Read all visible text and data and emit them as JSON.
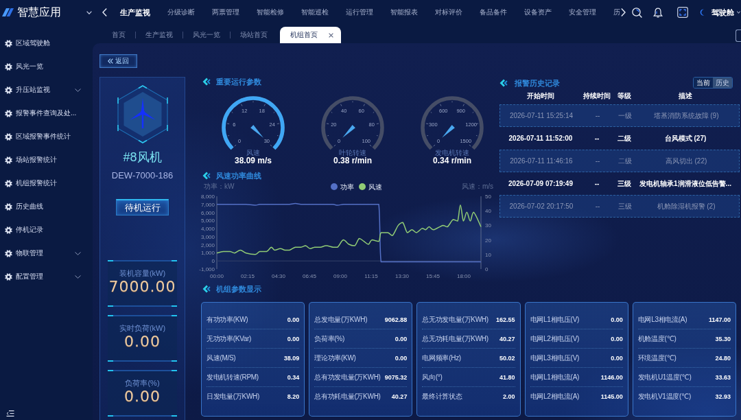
{
  "header": {
    "app_title": "智慧应用",
    "nav": [
      {
        "label": "生产监视",
        "selected": true
      },
      {
        "label": "分级诊断",
        "selected": false
      },
      {
        "label": "两票管理",
        "selected": false
      },
      {
        "label": "智能检修",
        "selected": false
      },
      {
        "label": "智能巡检",
        "selected": false
      },
      {
        "label": "运行管理",
        "selected": false
      },
      {
        "label": "智能报表",
        "selected": false
      },
      {
        "label": "对标评价",
        "selected": false
      },
      {
        "label": "备品备件",
        "selected": false
      },
      {
        "label": "设备资产",
        "selected": false
      },
      {
        "label": "安全管理",
        "selected": false
      },
      {
        "label": "历",
        "selected": false
      }
    ],
    "mode_switch": {
      "label": "驾驶舱",
      "dark_mode": true
    }
  },
  "tabs": [
    {
      "label": "首页",
      "selected": false
    },
    {
      "label": "生产监视",
      "selected": false
    },
    {
      "label": "风光一览",
      "selected": false
    },
    {
      "label": "场站首页",
      "selected": false
    },
    {
      "label": "机组首页",
      "selected": true
    }
  ],
  "sidebar": {
    "items": [
      {
        "label": "区域驾驶舱",
        "kind": "link"
      },
      {
        "label": "风光一览",
        "kind": "link"
      },
      {
        "label": "升压站监视",
        "kind": "group"
      },
      {
        "label": "报警事件查询及处...",
        "kind": "link"
      },
      {
        "label": "区域报警事件统计",
        "kind": "link"
      },
      {
        "label": "场站报警统计",
        "kind": "link"
      },
      {
        "label": "机组报警统计",
        "kind": "link"
      },
      {
        "label": "历史曲线",
        "kind": "link"
      },
      {
        "label": "停机记录",
        "kind": "link"
      },
      {
        "label": "物联管理",
        "kind": "group"
      },
      {
        "label": "配置管理",
        "kind": "group"
      }
    ]
  },
  "back_button": {
    "label": "返回"
  },
  "unit_panel": {
    "name": "#8风机",
    "model": "DEW-7000-186",
    "status": "待机运行",
    "stats": [
      {
        "label": "装机容量(kW)",
        "value": "7000.00"
      },
      {
        "label": "实时负荷(kW)",
        "value": "0.00"
      },
      {
        "label": "负荷率(%)",
        "value": "0.00"
      }
    ]
  },
  "run_params": {
    "title": "重要运行参数",
    "gauges": [
      {
        "label": "风速",
        "reading": "38.09 m/s",
        "level": 1,
        "ticks": [
          "0",
          "6",
          "12",
          "18",
          "24",
          "30"
        ]
      },
      {
        "label": "叶轮转速",
        "reading": "0.38 r/min",
        "ticks": [
          "0",
          "20",
          "40",
          "60",
          "80",
          "100"
        ]
      },
      {
        "label": "发电机转速",
        "reading": "0.34 r/min",
        "ticks": [
          "0",
          "300",
          "600",
          "900",
          "1200",
          "1500"
        ]
      }
    ]
  },
  "power_curve": {
    "title": "风速功率曲线",
    "chart_data": {
      "type": "line",
      "legend": "top",
      "ylabel": "功率：kW",
      "y2label": "风速：m/s",
      "x": [
        0,
        0.47,
        0.97,
        1.3,
        1.72,
        2.13,
        2.8,
        3.13,
        3.63,
        3.97,
        4.22,
        4.63,
        4.97,
        5.3,
        5.72,
        6.13,
        6.47,
        6.8,
        7.13,
        7.55,
        7.97,
        8.47,
        8.8,
        9.22,
        9.63,
        10.05,
        10.38,
        10.72,
        11.05,
        11.3,
        11.8,
        11.97,
        12.47,
        12.8,
        13.22,
        13.55,
        13.88,
        14.22,
        14.55,
        14.97,
        15.22,
        15.47,
        15.8,
        16.47,
        16.8,
        17.22,
        17.55,
        17.75,
        17.97,
        18.22,
        18.47,
        18.72,
        19.25
      ],
      "xlim": [
        0,
        19.25
      ],
      "xticks": [
        {
          "value": 0,
          "label": "00:00"
        },
        {
          "value": 2.25,
          "label": "02:15"
        },
        {
          "value": 4.5,
          "label": "04:30"
        },
        {
          "value": 6.75,
          "label": "06:45"
        },
        {
          "value": 9,
          "label": "09:00"
        },
        {
          "value": 11.25,
          "label": "11:15"
        },
        {
          "value": 13.5,
          "label": "13:30"
        },
        {
          "value": 15.75,
          "label": "15:45"
        },
        {
          "value": 18,
          "label": "18:00"
        }
      ],
      "ylim": [
        -1000,
        8000
      ],
      "yticks": [
        {
          "value": -1000,
          "label": "-1,000"
        },
        {
          "value": 0,
          "label": "0"
        },
        {
          "value": 1000,
          "label": "1,000"
        },
        {
          "value": 2000,
          "label": "2,000"
        },
        {
          "value": 3000,
          "label": "3,000"
        },
        {
          "value": 4000,
          "label": "4,000"
        },
        {
          "value": 5000,
          "label": "5,000"
        },
        {
          "value": 6000,
          "label": "6,000"
        },
        {
          "value": 7000,
          "label": "7,000"
        },
        {
          "value": 8000,
          "label": "8,000"
        }
      ],
      "y2lim": [
        0,
        50
      ],
      "y2ticks": [
        0,
        10,
        20,
        30,
        40,
        50
      ],
      "series": [
        {
          "name": "功率",
          "color": "#5470c6",
          "values": [
            7000,
            7000,
            7000,
            7000,
            7000,
            7000,
            6900,
            7000,
            7000,
            7000,
            7000,
            7000,
            7000,
            7000,
            7100,
            7000,
            7000,
            7000,
            7000,
            7000,
            7000,
            7000,
            6900,
            7000,
            7000,
            7000,
            7000,
            7000,
            7000,
            7000,
            7000,
            -100,
            -100,
            -100,
            -100,
            -100,
            -100,
            -100,
            -100,
            -100,
            -100,
            -100,
            -100,
            -100,
            -100,
            -100,
            -100,
            -100,
            -100,
            -100,
            -100,
            -100,
            -100
          ]
        },
        {
          "name": "风速",
          "color": "#91cc75",
          "axis": "y2",
          "values": [
            11,
            12,
            12,
            11,
            13,
            11,
            10,
            12,
            12,
            15,
            13,
            14,
            13,
            13,
            15,
            15,
            16,
            14,
            15,
            15,
            16,
            15,
            15,
            20,
            17,
            16,
            21,
            19,
            17,
            20,
            19,
            25,
            25,
            23,
            30,
            32,
            25,
            27,
            25,
            28,
            27,
            29,
            27,
            30,
            29,
            34,
            33,
            44,
            33,
            39,
            33,
            39,
            29
          ]
        }
      ]
    }
  },
  "alarm_history": {
    "title": "报警历史记录",
    "filters": [
      {
        "label": "当前",
        "selected": true
      },
      {
        "label": "历史",
        "selected": false
      }
    ],
    "columns": [
      "开始时间",
      "持续时间",
      "等级",
      "描述"
    ],
    "rows": [
      {
        "start": "2026-07-11 15:25:14",
        "duration": "--",
        "grade": "一级",
        "description": "塔基消防系统故障 (9)"
      },
      {
        "start": "2026-07-11 11:52:00",
        "duration": "--",
        "grade": "二级",
        "description": "台风模式 (27)"
      },
      {
        "start": "2026-07-11 11:46:16",
        "duration": "--",
        "grade": "二级",
        "description": "高风切出 (22)"
      },
      {
        "start": "2026-07-09 07:19:49",
        "duration": "--",
        "grade": "三级",
        "description": "发电机轴承1润滑液位低告警..."
      },
      {
        "start": "2026-07-02 20:17:50",
        "duration": "--",
        "grade": "三级",
        "description": "机舱除湿机报警 (2)"
      }
    ]
  },
  "unit_params": {
    "title": "机组参数显示",
    "cards": [
      {
        "rows": [
          {
            "label": "有功功率(KW)",
            "value": "0.00"
          },
          {
            "label": "无功功率(KVar)",
            "value": "0.00"
          },
          {
            "label": "风速(M/S)",
            "value": "38.09"
          },
          {
            "label": "发电机转速(RPM)",
            "value": "0.34"
          },
          {
            "label": "日发电量(万KWH)",
            "value": "8.20"
          }
        ]
      },
      {
        "rows": [
          {
            "label": "总发电量(万KWH)",
            "value": "9062.88"
          },
          {
            "label": "负荷率(%)",
            "value": "0.00"
          },
          {
            "label": "理论功率(KW)",
            "value": "0.00"
          },
          {
            "label": "总有功发电量(万KWH)",
            "value": "9075.32"
          },
          {
            "label": "总有功耗电量(万KWH)",
            "value": "40.27"
          }
        ]
      },
      {
        "rows": [
          {
            "label": "总无功发电量(万KWH)",
            "value": "162.55"
          },
          {
            "label": "总无功耗电量(万KWH)",
            "value": "40.27"
          },
          {
            "label": "电网频率(Hz)",
            "value": "50.02"
          },
          {
            "label": "风向(°)",
            "value": "41.80"
          },
          {
            "label": "最终计算状态",
            "value": "2.00"
          }
        ]
      },
      {
        "rows": [
          {
            "label": "电网L1相电压(V)",
            "value": "0.00"
          },
          {
            "label": "电网L2相电压(V)",
            "value": "0.00"
          },
          {
            "label": "电网L3相电压(V)",
            "value": "0.00"
          },
          {
            "label": "电网L1相电流(A)",
            "value": "1146.00"
          },
          {
            "label": "电网L2相电流(A)",
            "value": "1145.00"
          }
        ]
      },
      {
        "rows": [
          {
            "label": "电网L3相电流(A)",
            "value": "1147.00"
          },
          {
            "label": "机舱温度(℃)",
            "value": "35.30"
          },
          {
            "label": "环境温度(℃)",
            "value": "24.80"
          },
          {
            "label": "发电机U1温度(℃)",
            "value": "33.63"
          },
          {
            "label": "发电机V1温度(℃)",
            "value": "32.93"
          }
        ]
      }
    ]
  }
}
